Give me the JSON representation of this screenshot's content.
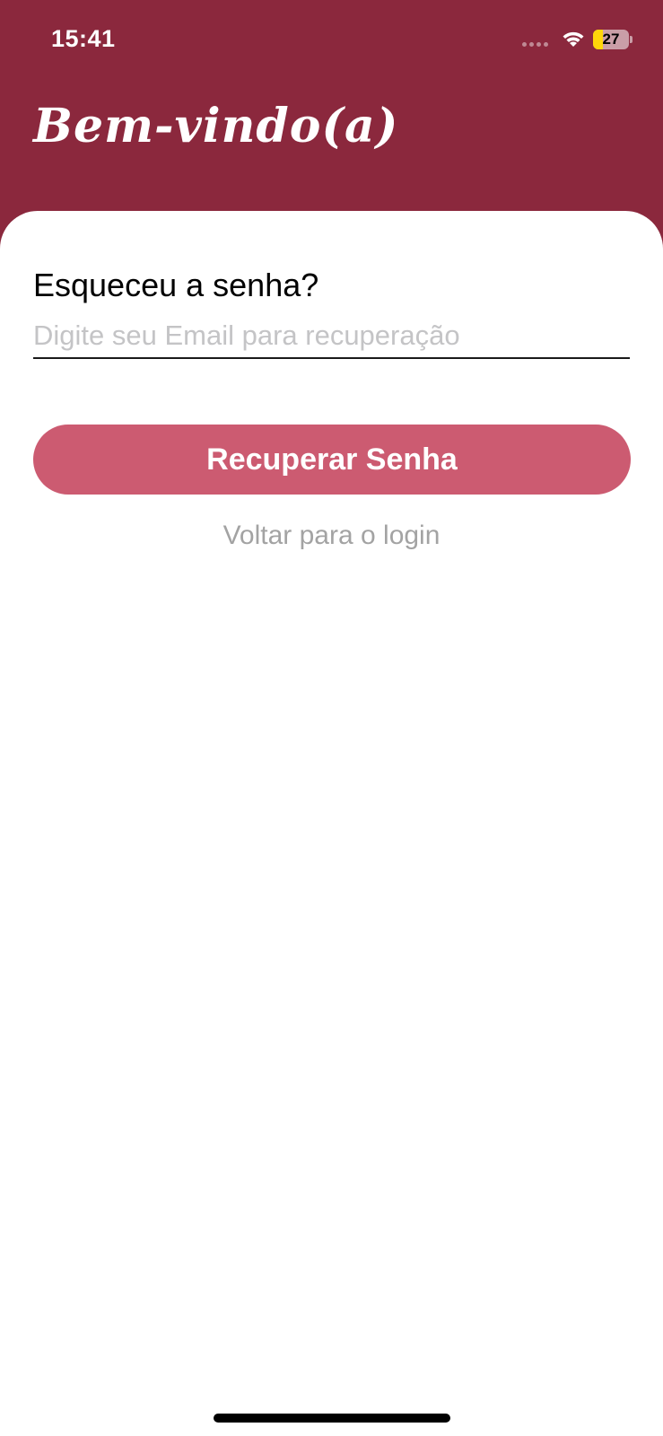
{
  "status_bar": {
    "time": "15:41",
    "battery_level": "27",
    "battery_percent": 27,
    "wifi_icon": "wifi-icon",
    "signal_icon": "cellular-signal-icon",
    "battery_icon": "battery-icon",
    "battery_color": "#ffd60a"
  },
  "header": {
    "title": "Bem-vindo(a)",
    "background_color": "#8b283d"
  },
  "form": {
    "heading": "Esqueceu a senha?",
    "email_placeholder": "Digite seu Email para recuperação",
    "email_value": "",
    "submit_label": "Recuperar Senha",
    "submit_color": "#cc5b71",
    "back_link_label": "Voltar para o login"
  }
}
